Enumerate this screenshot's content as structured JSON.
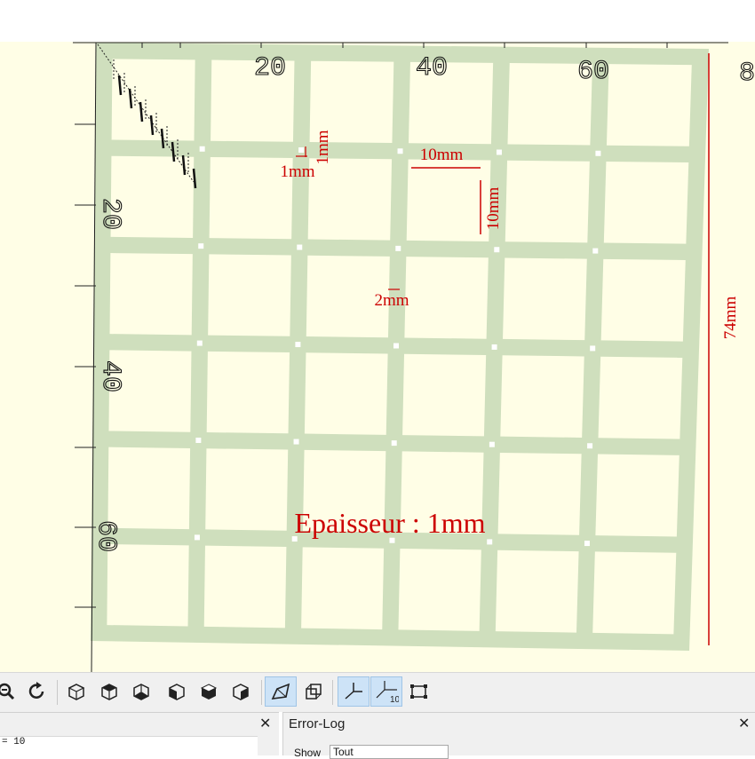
{
  "viewport": {
    "dimension_width": "74mm",
    "dimension_height": "74mm",
    "dimension_cell_width": "10mm",
    "dimension_cell_height": "10mm",
    "dimension_gap_small": "1mm",
    "dimension_gap_small_vertical": "1mm",
    "dimension_bar": "2mm",
    "thickness_label": "Epaisseur : 1mm",
    "ruler_x_labels": [
      "20",
      "40",
      "60",
      "8"
    ],
    "ruler_y_labels": [
      "20",
      "40",
      "60"
    ],
    "colors": {
      "background": "#fffee6",
      "grid": "#cfdfbd",
      "annotation": "#cc0000"
    },
    "grid_rows": 6,
    "grid_cols": 6
  },
  "toolbar": {
    "buttons": [
      {
        "name": "zoom-button",
        "icon": "zoom-out-icon"
      },
      {
        "name": "reset-view-button",
        "icon": "reset-view-icon"
      },
      {
        "name": "view-right-button",
        "icon": "view-right-icon"
      },
      {
        "name": "view-top-button",
        "icon": "view-top-icon"
      },
      {
        "name": "view-bottom-button",
        "icon": "view-bottom-icon"
      },
      {
        "name": "view-left-button",
        "icon": "view-left-icon"
      },
      {
        "name": "view-front-button",
        "icon": "view-front-icon"
      },
      {
        "name": "view-back-button",
        "icon": "view-back-icon"
      },
      {
        "name": "perspective-button",
        "icon": "perspective-icon"
      },
      {
        "name": "orthogonal-button",
        "icon": "orthogonal-icon"
      },
      {
        "name": "show-axes-button",
        "icon": "axes-icon"
      },
      {
        "name": "show-scale-markers-button",
        "icon": "scale-markers-icon"
      },
      {
        "name": "show-edges-button",
        "icon": "edges-icon"
      }
    ],
    "scale_badge": "10"
  },
  "console": {
    "close_label": "✕",
    "line": "= 10"
  },
  "error_log": {
    "title": "Error-Log",
    "close_label": "✕",
    "show_label": "Show",
    "show_value": "Tout"
  }
}
